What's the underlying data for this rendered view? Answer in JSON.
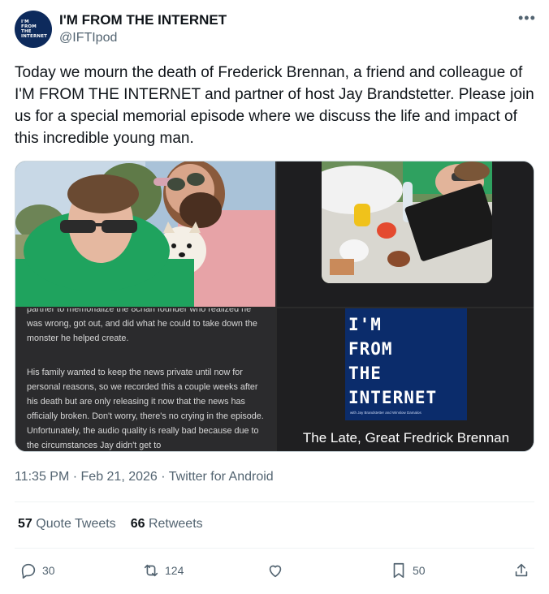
{
  "account": {
    "name": "I'M FROM THE INTERNET",
    "handle": "@IFTIpod",
    "avatar_lines": [
      "I'M",
      "FROM",
      "THE",
      "INTERNET"
    ]
  },
  "tweet": {
    "text": "Today we mourn the death of Frederick Brennan, a friend and colleague of I'M FROM THE INTERNET and partner of host Jay Brandstetter. Please join us for a special memorial episode where we discuss the life and impact of this incredible young man.",
    "more_icon": "more-horizontal-icon"
  },
  "media": {
    "screenshot_paragraph_1": "partner to memorialize the 8chan founder who realized he was wrong, got out, and did what he could to take down the monster he helped create.",
    "screenshot_paragraph_2": "His family wanted to keep the news private until now for personal reasons, so we recorded this a couple weeks after his death but are only releasing it now that the news has officially broken. Don't worry, there's no crying in the episode. Unfortunately, the audio quality is really bad because due to the circumstances Jay didn't get to",
    "cover_lines": [
      "I'M",
      "FROM",
      "THE",
      "INTERNET"
    ],
    "cover_credits": "with Jay Brandstetter and Winslow Damalos",
    "caption": "The Late, Great Fredrick Brennan"
  },
  "meta": {
    "time": "11:35 PM",
    "date": "Feb 21, 2026",
    "source": "Twitter for Android",
    "line": "11:35 PM · Feb 21, 2026 · Twitter for Android"
  },
  "stats": {
    "quote_count": "57",
    "quote_label": "Quote Tweets",
    "retweet_count": "66",
    "retweet_label": "Retweets"
  },
  "actions": {
    "reply": {
      "icon": "reply-icon",
      "count": "30"
    },
    "retweet": {
      "icon": "retweet-icon",
      "count": "124"
    },
    "like": {
      "icon": "heart-icon"
    },
    "bookmark": {
      "icon": "bookmark-icon",
      "count": "50"
    },
    "share": {
      "icon": "share-icon"
    }
  }
}
